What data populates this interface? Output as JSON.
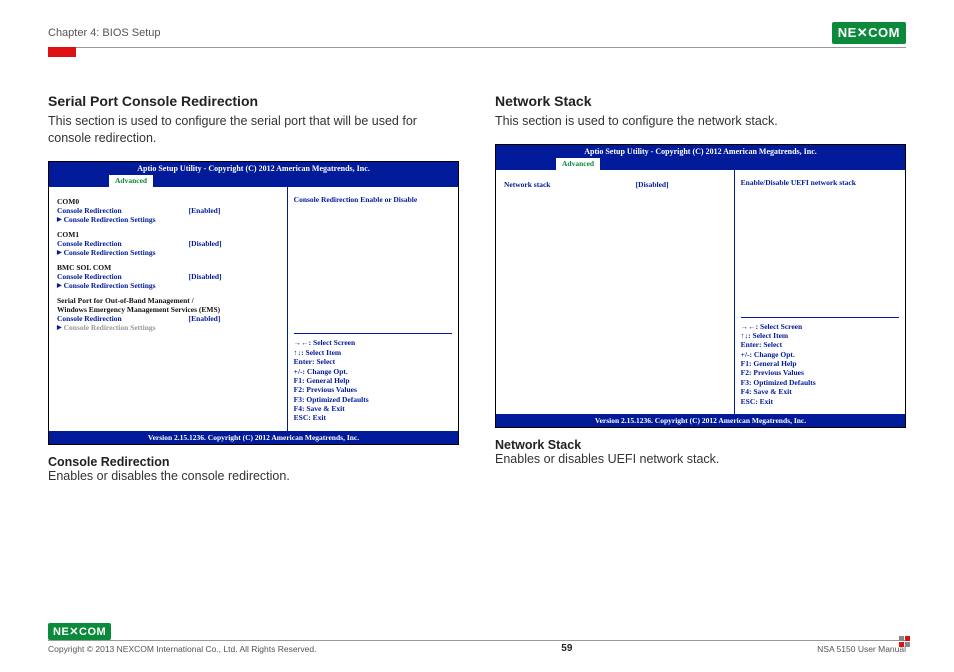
{
  "header": {
    "chapter": "Chapter 4: BIOS Setup",
    "brand": "NE✕COM"
  },
  "left": {
    "title": "Serial Port Console Redirection",
    "desc": "This section is used to configure the serial port that will be used for console redirection.",
    "bios": {
      "title": "Aptio Setup Utility - Copyright (C) 2012 American Megatrends, Inc.",
      "tab": "Advanced",
      "groups": {
        "com0": {
          "name": "COM0",
          "cr_label": "Console Redirection",
          "cr_val": "[Enabled]",
          "settings": "Console Redirection Settings"
        },
        "com1": {
          "name": "COM1",
          "cr_label": "Console Redirection",
          "cr_val": "[Disabled]",
          "settings": "Console Redirection Settings"
        },
        "bmc": {
          "name": "BMC SOL COM",
          "cr_label": "Console Redirection",
          "cr_val": "[Disabled]",
          "settings": "Console Redirection Settings"
        },
        "oob": {
          "name1": "Serial Port for Out-of-Band Management /",
          "name2": "Windows Emergency Management Services (EMS)",
          "cr_label": "Console Redirection",
          "cr_val": "[Enabled]",
          "settings": "Console Redirection Settings"
        }
      },
      "help": "Console Redirection Enable or Disable",
      "keys": {
        "k1": "→←: Select Screen",
        "k2": "↑↓: Select Item",
        "k3": "Enter: Select",
        "k4": "+/-: Change Opt.",
        "k5": "F1: General Help",
        "k6": "F2: Previous Values",
        "k7": "F3: Optimized Defaults",
        "k8": "F4: Save & Exit",
        "k9": "ESC: Exit"
      },
      "footer": "Version 2.15.1236. Copyright (C) 2012 American Megatrends, Inc."
    },
    "sub_title": "Console Redirection",
    "sub_desc": "Enables or disables the console redirection."
  },
  "right": {
    "title": "Network Stack",
    "desc": "This section is used to configure the network stack.",
    "bios": {
      "title": "Aptio Setup Utility - Copyright (C) 2012 American Megatrends, Inc.",
      "tab": "Advanced",
      "item_label": "Network stack",
      "item_val": "[Disabled]",
      "help": "Enable/Disable UEFI network stack",
      "keys": {
        "k1": "→←: Select Screen",
        "k2": "↑↓: Select Item",
        "k3": "Enter: Select",
        "k4": "+/-: Change Opt.",
        "k5": "F1: General Help",
        "k6": "F2: Previous Values",
        "k7": "F3: Optimized Defaults",
        "k8": "F4: Save & Exit",
        "k9": "ESC: Exit"
      },
      "footer": "Version 2.15.1236. Copyright (C) 2012 American Megatrends, Inc."
    },
    "sub_title": "Network Stack",
    "sub_desc": "Enables or disables UEFI network stack."
  },
  "footer": {
    "copyright": "Copyright © 2013 NEXCOM International Co., Ltd. All Rights Reserved.",
    "page": "59",
    "doc": "NSA 5150 User Manual"
  }
}
